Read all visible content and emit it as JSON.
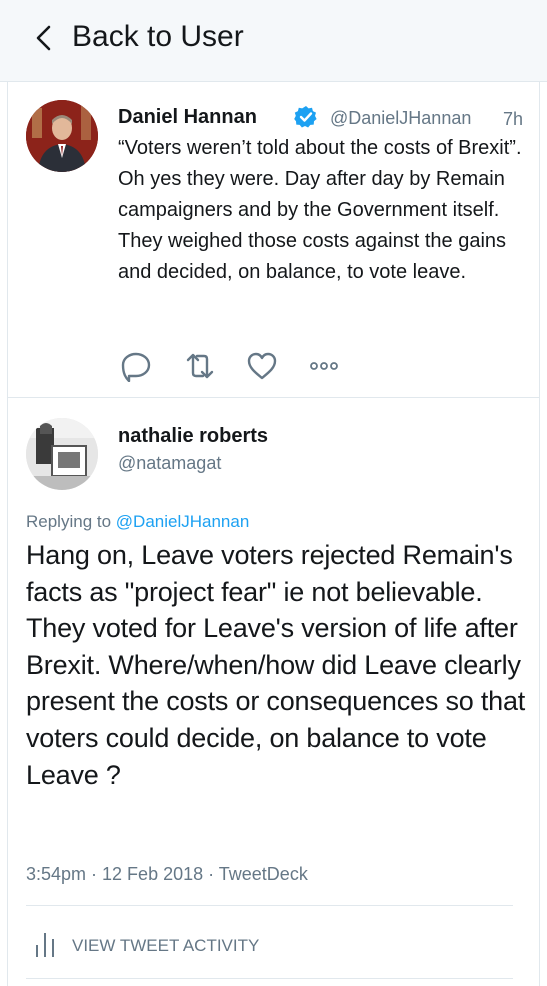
{
  "header": {
    "back_label": "Back to User"
  },
  "tweet1": {
    "author_name": "Daniel Hannan",
    "author_handle": "@DanielJHannan",
    "time": "7h",
    "verified": true,
    "text": "“Voters weren’t told about the costs of Brexit”. Oh yes they were. Day after day by Remain campaigners and by the Government itself. They weighed those costs against the gains and decided, on balance, to vote leave.",
    "actions": [
      "reply-icon",
      "retweet-icon",
      "like-icon",
      "more-icon"
    ]
  },
  "tweet2": {
    "author_name": "nathalie roberts",
    "author_handle": "@natamagat",
    "replying_prefix": "Replying to ",
    "replying_handle": "@DanielJHannan",
    "text": "Hang on, Leave voters rejected Remain's facts as \"project fear\" ie not believable. They voted for Leave's version of life after Brexit. Where/when/how did Leave clearly present the costs or consequences so that voters could decide, on balance to vote Leave ?",
    "timestamp": "3:54pm · 12 Feb 2018 · TweetDeck"
  },
  "footer": {
    "activity_label": "VIEW TWEET ACTIVITY"
  },
  "colors": {
    "accent": "#1da1f2",
    "muted": "#657786",
    "text": "#14171a",
    "header_bg": "#f5f8fa",
    "divider": "#e1e8ed"
  }
}
